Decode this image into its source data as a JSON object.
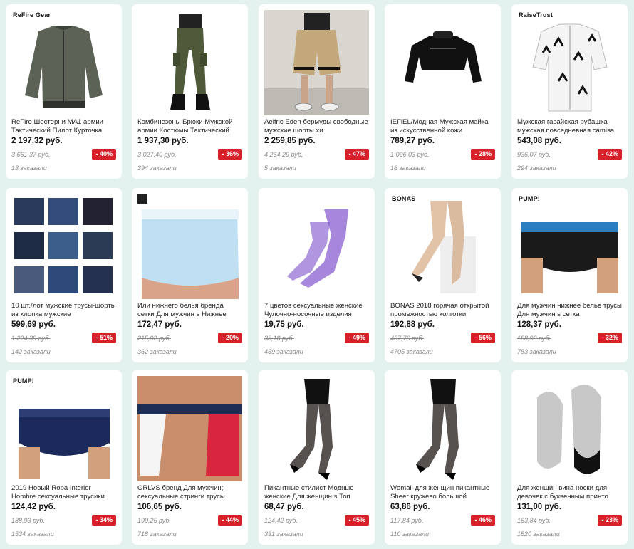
{
  "products": [
    {
      "brand": "ReFire Gear",
      "title": "ReFire Шестерни MA1 армии Тактический Пилот Курточка",
      "price": "2 197,32 руб.",
      "old_price": "3 661,37 руб.",
      "discount": "- 40%",
      "orders": "13 заказали",
      "icon": "bomber-jacket-image"
    },
    {
      "brand": "",
      "title": "Комбинезоны Брюки Мужской армии Костюмы Тактический",
      "price": "1 937,30 руб.",
      "old_price": "3 027,40 руб.",
      "discount": "- 36%",
      "orders": "394 заказали",
      "icon": "cargo-pants-image"
    },
    {
      "brand": "",
      "title": "Aelfric Eden бермуды свободные мужские шорты хи",
      "price": "2 259,85 руб.",
      "old_price": "4 264,29 руб.",
      "discount": "- 47%",
      "orders": "5 заказали",
      "icon": "shorts-image"
    },
    {
      "brand": "",
      "title": "IEFiEL/Модная Мужская майка из искусственной кожи",
      "price": "789,27 руб.",
      "old_price": "1 096,03 руб.",
      "discount": "- 28%",
      "orders": "18 заказали",
      "icon": "leather-top-image"
    },
    {
      "brand": "RaiseTrust",
      "title": "Мужская гавайская рубашка мужская повседневная camisa",
      "price": "543,08 руб.",
      "old_price": "936,07 руб.",
      "discount": "- 42%",
      "orders": "294 заказали",
      "icon": "hawaiian-shirt-image"
    },
    {
      "brand": "",
      "title": "10 шт./лот мужские трусы-шорты из хлопка мужские",
      "price": "599,69 руб.",
      "old_price": "1 224,39 руб.",
      "discount": "- 51%",
      "orders": "142 заказали",
      "icon": "boxers-set-image"
    },
    {
      "brand": "",
      "title": "Или нижнего белья бренда сетки Для мужчин s Нижнее",
      "price": "172,47 руб.",
      "old_price": "215,92 руб.",
      "discount": "- 20%",
      "orders": "362 заказали",
      "icon": "mesh-boxer-image"
    },
    {
      "brand": "",
      "title": "7 цветов сексуальные женские Чулочно-носочные изделия",
      "price": "19,75 руб.",
      "old_price": "38,18 руб.",
      "discount": "- 49%",
      "orders": "469 заказали",
      "icon": "fishnet-stockings-image"
    },
    {
      "brand": "BONAS",
      "title": "BONAS 2018 горячая открытой промежностью колготки",
      "price": "192,88 руб.",
      "old_price": "437,76 руб.",
      "discount": "- 56%",
      "orders": "4705 заказали",
      "icon": "pantyhose-image"
    },
    {
      "brand": "PUMP!",
      "title": "Для мужчин нижнее белье трусы Для мужчин s сетка",
      "price": "128,37 руб.",
      "old_price": "188,93 руб.",
      "discount": "- 32%",
      "orders": "783 заказали",
      "icon": "briefs-image"
    },
    {
      "brand": "PUMP!",
      "title": "2019 Новый Ropa Interior Hombre сексуальные трусики",
      "price": "124,42 руб.",
      "old_price": "188,93 руб.",
      "discount": "- 34%",
      "orders": "1534 заказали",
      "icon": "navy-briefs-image"
    },
    {
      "brand": "",
      "title": "ORLVS бренд Для мужчин; сексуальные стринги трусы",
      "price": "106,65 руб.",
      "old_price": "190,25 руб.",
      "discount": "- 44%",
      "orders": "718 заказали",
      "icon": "jockstrap-image"
    },
    {
      "brand": "",
      "title": "Пикантные стилист Модные женские Для женщин s Топ",
      "price": "68,47 руб.",
      "old_price": "124,42 руб.",
      "discount": "- 45%",
      "orders": "331 заказали",
      "icon": "dotted-stockings-image"
    },
    {
      "brand": "",
      "title": "Womail для женщин пикантные Sheer кружево большой",
      "price": "63,86 руб.",
      "old_price": "117,84 руб.",
      "discount": "- 46%",
      "orders": "110 заказали",
      "icon": "dotted-stockings-image"
    },
    {
      "brand": "",
      "title": "Для женщин вина носки для девочек с буквенным принто",
      "price": "131,00 руб.",
      "old_price": "163,84 руб.",
      "discount": "- 23%",
      "orders": "1520 заказали",
      "icon": "socks-image"
    }
  ]
}
